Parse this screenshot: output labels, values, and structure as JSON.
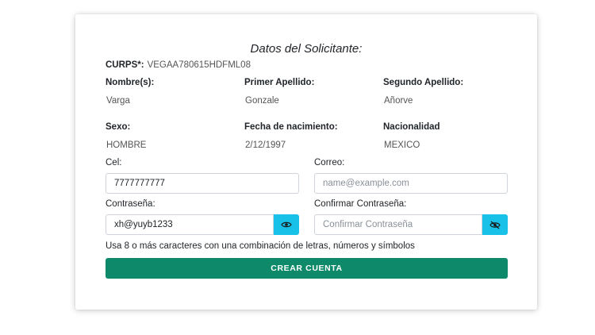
{
  "form": {
    "title": "Datos del Solicitante:",
    "curps": {
      "label": "CURPS*:",
      "value": "VEGAA780615HDFML08"
    },
    "fields": [
      {
        "label": "Nombre(s):",
        "value": "Varga"
      },
      {
        "label": "Primer Apellido:",
        "value": "Gonzale"
      },
      {
        "label": "Segundo Apellido:",
        "value": "Añorve"
      },
      {
        "label": "Sexo:",
        "value": "HOMBRE"
      },
      {
        "label": "Fecha de nacimiento:",
        "value": "2/12/1997"
      },
      {
        "label": "Nacionalidad",
        "value": "MEXICO"
      }
    ],
    "cel": {
      "label": "Cel:",
      "value": "7777777777"
    },
    "correo": {
      "label": "Correo:",
      "placeholder": "name@example.com"
    },
    "password": {
      "label": "Contraseña:",
      "value": "xh@yuyb1233",
      "icon": "eye-icon"
    },
    "confirm_password": {
      "label": "Confirmar Contraseña:",
      "placeholder": "Confirmar Contraseña",
      "icon": "eye-slash-icon"
    },
    "hint": "Usa 8 o más caracteres con una combinación de letras, números y símbolos",
    "submit_label": "CREAR CUENTA"
  },
  "colors": {
    "accent": "#0e8a6a",
    "eye_button": "#17c1e8"
  }
}
